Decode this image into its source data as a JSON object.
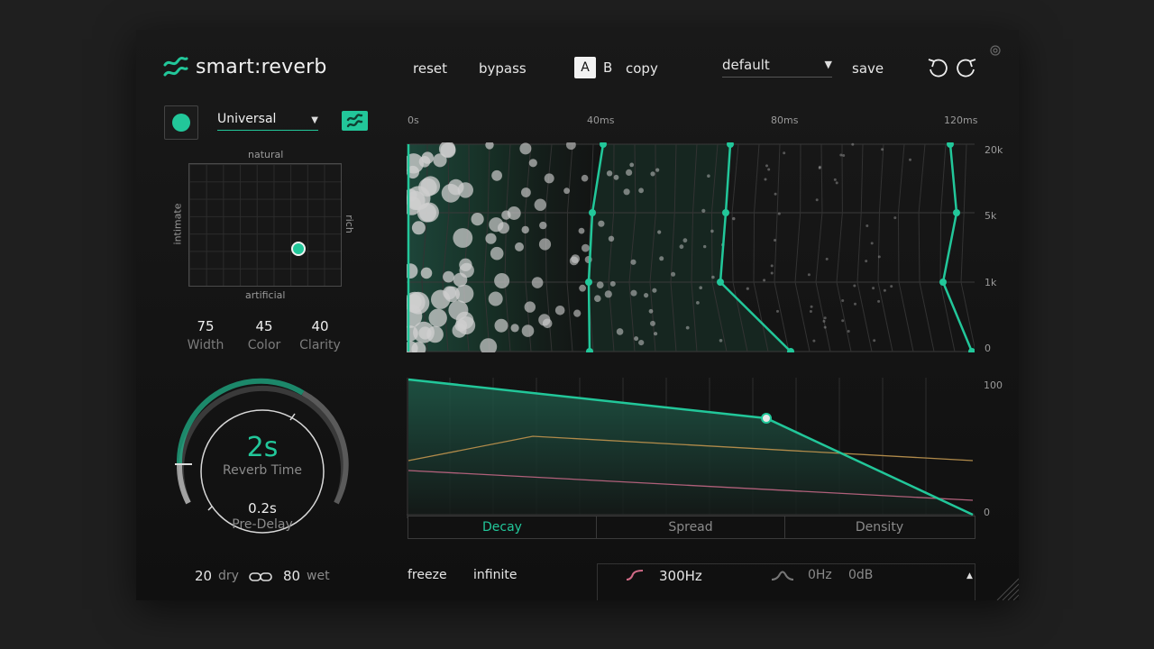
{
  "app": {
    "name": "smart:reverb"
  },
  "toolbar": {
    "reset": "reset",
    "bypass": "bypass",
    "ab_a": "A",
    "ab_b": "B",
    "copy": "copy",
    "preset": "default",
    "save": "save"
  },
  "profile": {
    "selected": "Universal"
  },
  "xy_pad": {
    "top_label": "natural",
    "bottom_label": "artificial",
    "left_label": "intimate",
    "right_label": "rich"
  },
  "knobs": [
    {
      "value": "75",
      "label": "Width"
    },
    {
      "value": "45",
      "label": "Color"
    },
    {
      "value": "40",
      "label": "Clarity"
    }
  ],
  "reverb": {
    "time_value": "2s",
    "time_label": "Reverb Time",
    "predelay_value": "0.2s",
    "predelay_label": "Pre-Delay"
  },
  "mix": {
    "dry_value": "20",
    "dry_label": "dry",
    "wet_value": "80",
    "wet_label": "wet"
  },
  "time_axis": [
    "0s",
    "40ms",
    "80ms",
    "120ms"
  ],
  "freq_axis": [
    "20k",
    "5k",
    "1k",
    "0"
  ],
  "level_axis": [
    "100",
    "0"
  ],
  "tabs": [
    "Decay",
    "Spread",
    "Density"
  ],
  "bottom": {
    "freeze": "freeze",
    "infinite": "infinite",
    "lowcut_freq": "300Hz",
    "band_freq": "0Hz",
    "band_gain": "0dB"
  },
  "colors": {
    "accent": "#22c79a",
    "background": "#141414",
    "spread_line": "#b08a4a",
    "density_line": "#b0607a"
  }
}
